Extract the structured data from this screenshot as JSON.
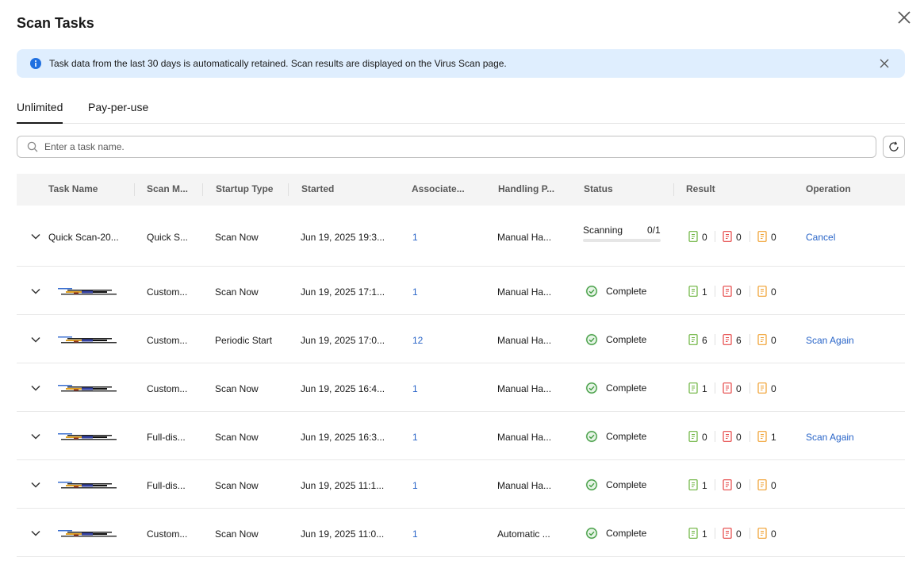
{
  "dialog": {
    "title": "Scan Tasks"
  },
  "notice": {
    "message": "Task data from the last 30 days is automatically retained. Scan results are displayed on the Virus Scan page."
  },
  "tabs": [
    {
      "label": "Unlimited",
      "active": true
    },
    {
      "label": "Pay-per-use",
      "active": false
    }
  ],
  "search": {
    "placeholder": "Enter a task name.",
    "value": ""
  },
  "table": {
    "headers": [
      "Task Name",
      "Scan M...",
      "Startup Type",
      "Started",
      "Associate...",
      "Handling P...",
      "Status",
      "Result",
      "Operation"
    ],
    "rows": [
      {
        "task_name": "Quick Scan-20...",
        "scan_mode": "Quick S...",
        "startup_type": "Scan Now",
        "started": "Jun 19, 2025 19:3...",
        "associated": "1",
        "handling": "Manual Ha...",
        "status": "Scanning",
        "progress_text": "0/1",
        "progress": 0,
        "result": {
          "green": "0",
          "red": "0",
          "orange": "0"
        },
        "operation": "Cancel"
      },
      {
        "task_name": "",
        "scan_mode": "Custom...",
        "startup_type": "Scan Now",
        "started": "Jun 19, 2025 17:1...",
        "associated": "1",
        "handling": "Manual Ha...",
        "status": "Complete",
        "result": {
          "green": "1",
          "red": "0",
          "orange": "0"
        },
        "operation": ""
      },
      {
        "task_name": "",
        "scan_mode": "Custom...",
        "startup_type": "Periodic Start",
        "started": "Jun 19, 2025 17:0...",
        "associated": "12",
        "handling": "Manual Ha...",
        "status": "Complete",
        "result": {
          "green": "6",
          "red": "6",
          "orange": "0"
        },
        "operation": "Scan Again"
      },
      {
        "task_name": "",
        "scan_mode": "Custom...",
        "startup_type": "Scan Now",
        "started": "Jun 19, 2025 16:4...",
        "associated": "1",
        "handling": "Manual Ha...",
        "status": "Complete",
        "result": {
          "green": "1",
          "red": "0",
          "orange": "0"
        },
        "operation": ""
      },
      {
        "task_name": "",
        "scan_mode": "Full-dis...",
        "startup_type": "Scan Now",
        "started": "Jun 19, 2025 16:3...",
        "associated": "1",
        "handling": "Manual Ha...",
        "status": "Complete",
        "result": {
          "green": "0",
          "red": "0",
          "orange": "1"
        },
        "operation": "Scan Again"
      },
      {
        "task_name": "",
        "scan_mode": "Full-dis...",
        "startup_type": "Scan Now",
        "started": "Jun 19, 2025 11:1...",
        "associated": "1",
        "handling": "Manual Ha...",
        "status": "Complete",
        "result": {
          "green": "1",
          "red": "0",
          "orange": "0"
        },
        "operation": ""
      },
      {
        "task_name": "",
        "scan_mode": "Custom...",
        "startup_type": "Scan Now",
        "started": "Jun 19, 2025 11:0...",
        "associated": "1",
        "handling": "Automatic ...",
        "status": "Complete",
        "result": {
          "green": "1",
          "red": "0",
          "orange": "0"
        },
        "operation": ""
      }
    ]
  },
  "colors": {
    "link": "#2965c8",
    "success": "#3f9a3f",
    "result_green": "#6cb33e",
    "result_red": "#e54545",
    "result_orange": "#f0a030",
    "notice_bg": "#dfeefe",
    "info": "#2070e0"
  },
  "icons": [
    "close-icon",
    "info-icon",
    "search-icon",
    "refresh-icon",
    "chevron-down-icon",
    "check-circle-icon",
    "file-icon"
  ]
}
